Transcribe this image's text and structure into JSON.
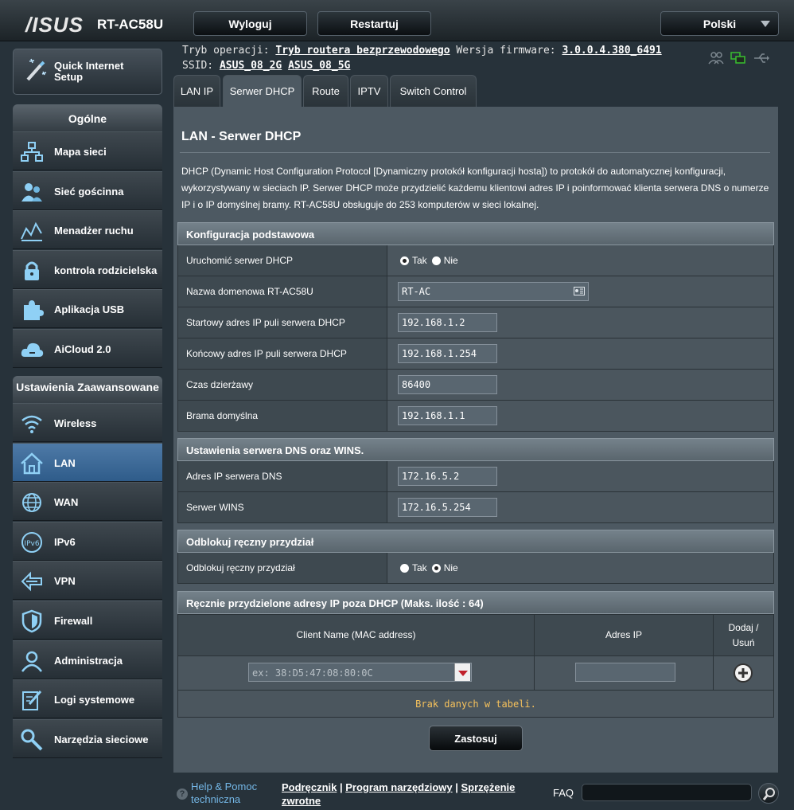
{
  "header": {
    "logo": "/ISUS",
    "model": "RT-AC58U",
    "logout_label": "Wyloguj",
    "restart_label": "Restartuj",
    "language": "Polski"
  },
  "status": {
    "mode_label": "Tryb operacji:",
    "mode_value": "Tryb routera bezprzewodowego",
    "firmware_label": "Wersja firmware:",
    "firmware_value": "3.0.0.4.380_6491",
    "ssid_label": "SSID:",
    "ssid_1": "ASUS_08_2G",
    "ssid_2": "ASUS_08_5G"
  },
  "sidebar": {
    "qis_label": "Quick Internet Setup",
    "general_title": "Ogólne",
    "general_items": [
      {
        "label": "Mapa sieci",
        "icon": "network-map-icon"
      },
      {
        "label": "Sieć gościnna",
        "icon": "guest-network-icon"
      },
      {
        "label": "Menadżer ruchu",
        "icon": "traffic-manager-icon"
      },
      {
        "label": "kontrola rodzicielska",
        "icon": "lock-icon"
      },
      {
        "label": "Aplikacja USB",
        "icon": "puzzle-icon"
      },
      {
        "label": "AiCloud 2.0",
        "icon": "cloud-icon"
      }
    ],
    "advanced_title": "Ustawienia Zaawansowane",
    "advanced_items": [
      {
        "label": "Wireless",
        "icon": "wifi-icon"
      },
      {
        "label": "LAN",
        "icon": "home-icon"
      },
      {
        "label": "WAN",
        "icon": "globe-icon"
      },
      {
        "label": "IPv6",
        "icon": "ipv6-icon"
      },
      {
        "label": "VPN",
        "icon": "vpn-icon"
      },
      {
        "label": "Firewall",
        "icon": "shield-icon"
      },
      {
        "label": "Administracja",
        "icon": "admin-icon"
      },
      {
        "label": "Logi systemowe",
        "icon": "log-icon"
      },
      {
        "label": "Narzędzia sieciowe",
        "icon": "tools-icon"
      }
    ]
  },
  "tabs": [
    "LAN IP",
    "Serwer DHCP",
    "Route",
    "IPTV",
    "Switch Control"
  ],
  "page": {
    "title": "LAN - Serwer DHCP",
    "description": "DHCP (Dynamic Host Configuration Protocol [Dynamiczny protokół konfiguracji hosta]) to protokół do automatycznej konfiguracji, wykorzystywany w sieciach IP. Serwer DHCP może przydzielić każdemu klientowi adres IP i poinformować klienta serwera DNS o numerze IP i o IP domyślnej bramy. RT-AC58U obsługuje do 253 komputerów w sieci lokalnej."
  },
  "basic": {
    "title": "Konfiguracja podstawowa",
    "enable_label": "Uruchomić serwer DHCP",
    "yes": "Tak",
    "no": "Nie",
    "domain_label": "Nazwa domenowa RT-AC58U",
    "domain_value": "RT-AC",
    "start_label": "Startowy adres IP puli serwera DHCP",
    "start_value": "192.168.1.2",
    "end_label": "Końcowy adres IP puli serwera DHCP",
    "end_value": "192.168.1.254",
    "lease_label": "Czas dzierżawy",
    "lease_value": "86400",
    "gateway_label": "Brama domyślna",
    "gateway_value": "192.168.1.1"
  },
  "dns": {
    "title": "Ustawienia serwera DNS oraz WINS.",
    "dns_label": "Adres IP serwera DNS",
    "dns_value": "172.16.5.2",
    "wins_label": "Serwer WINS",
    "wins_value": "172.16.5.254"
  },
  "manual": {
    "title": "Odblokuj ręczny przydział",
    "label": "Odblokuj ręczny przydział",
    "yes": "Tak",
    "no": "Nie"
  },
  "manual_list": {
    "title": "Ręcznie przydzielone adresy IP poza DHCP (Maks. ilość : 64)",
    "col_client": "Client Name (MAC address)",
    "col_ip": "Adres IP",
    "col_add": "Dodaj / Usuń",
    "client_placeholder": "ex: 38:D5:47:08:80:0C",
    "empty_text": "Brak danych w tabeli."
  },
  "apply_label": "Zastosuj",
  "footer": {
    "help_label": "Help & Pomoc techniczna",
    "link_manual": "Podręcznik",
    "link_utility": "Program narzędziowy",
    "link_feedback": "Sprzężenie zwrotne",
    "faq_label": "FAQ"
  }
}
